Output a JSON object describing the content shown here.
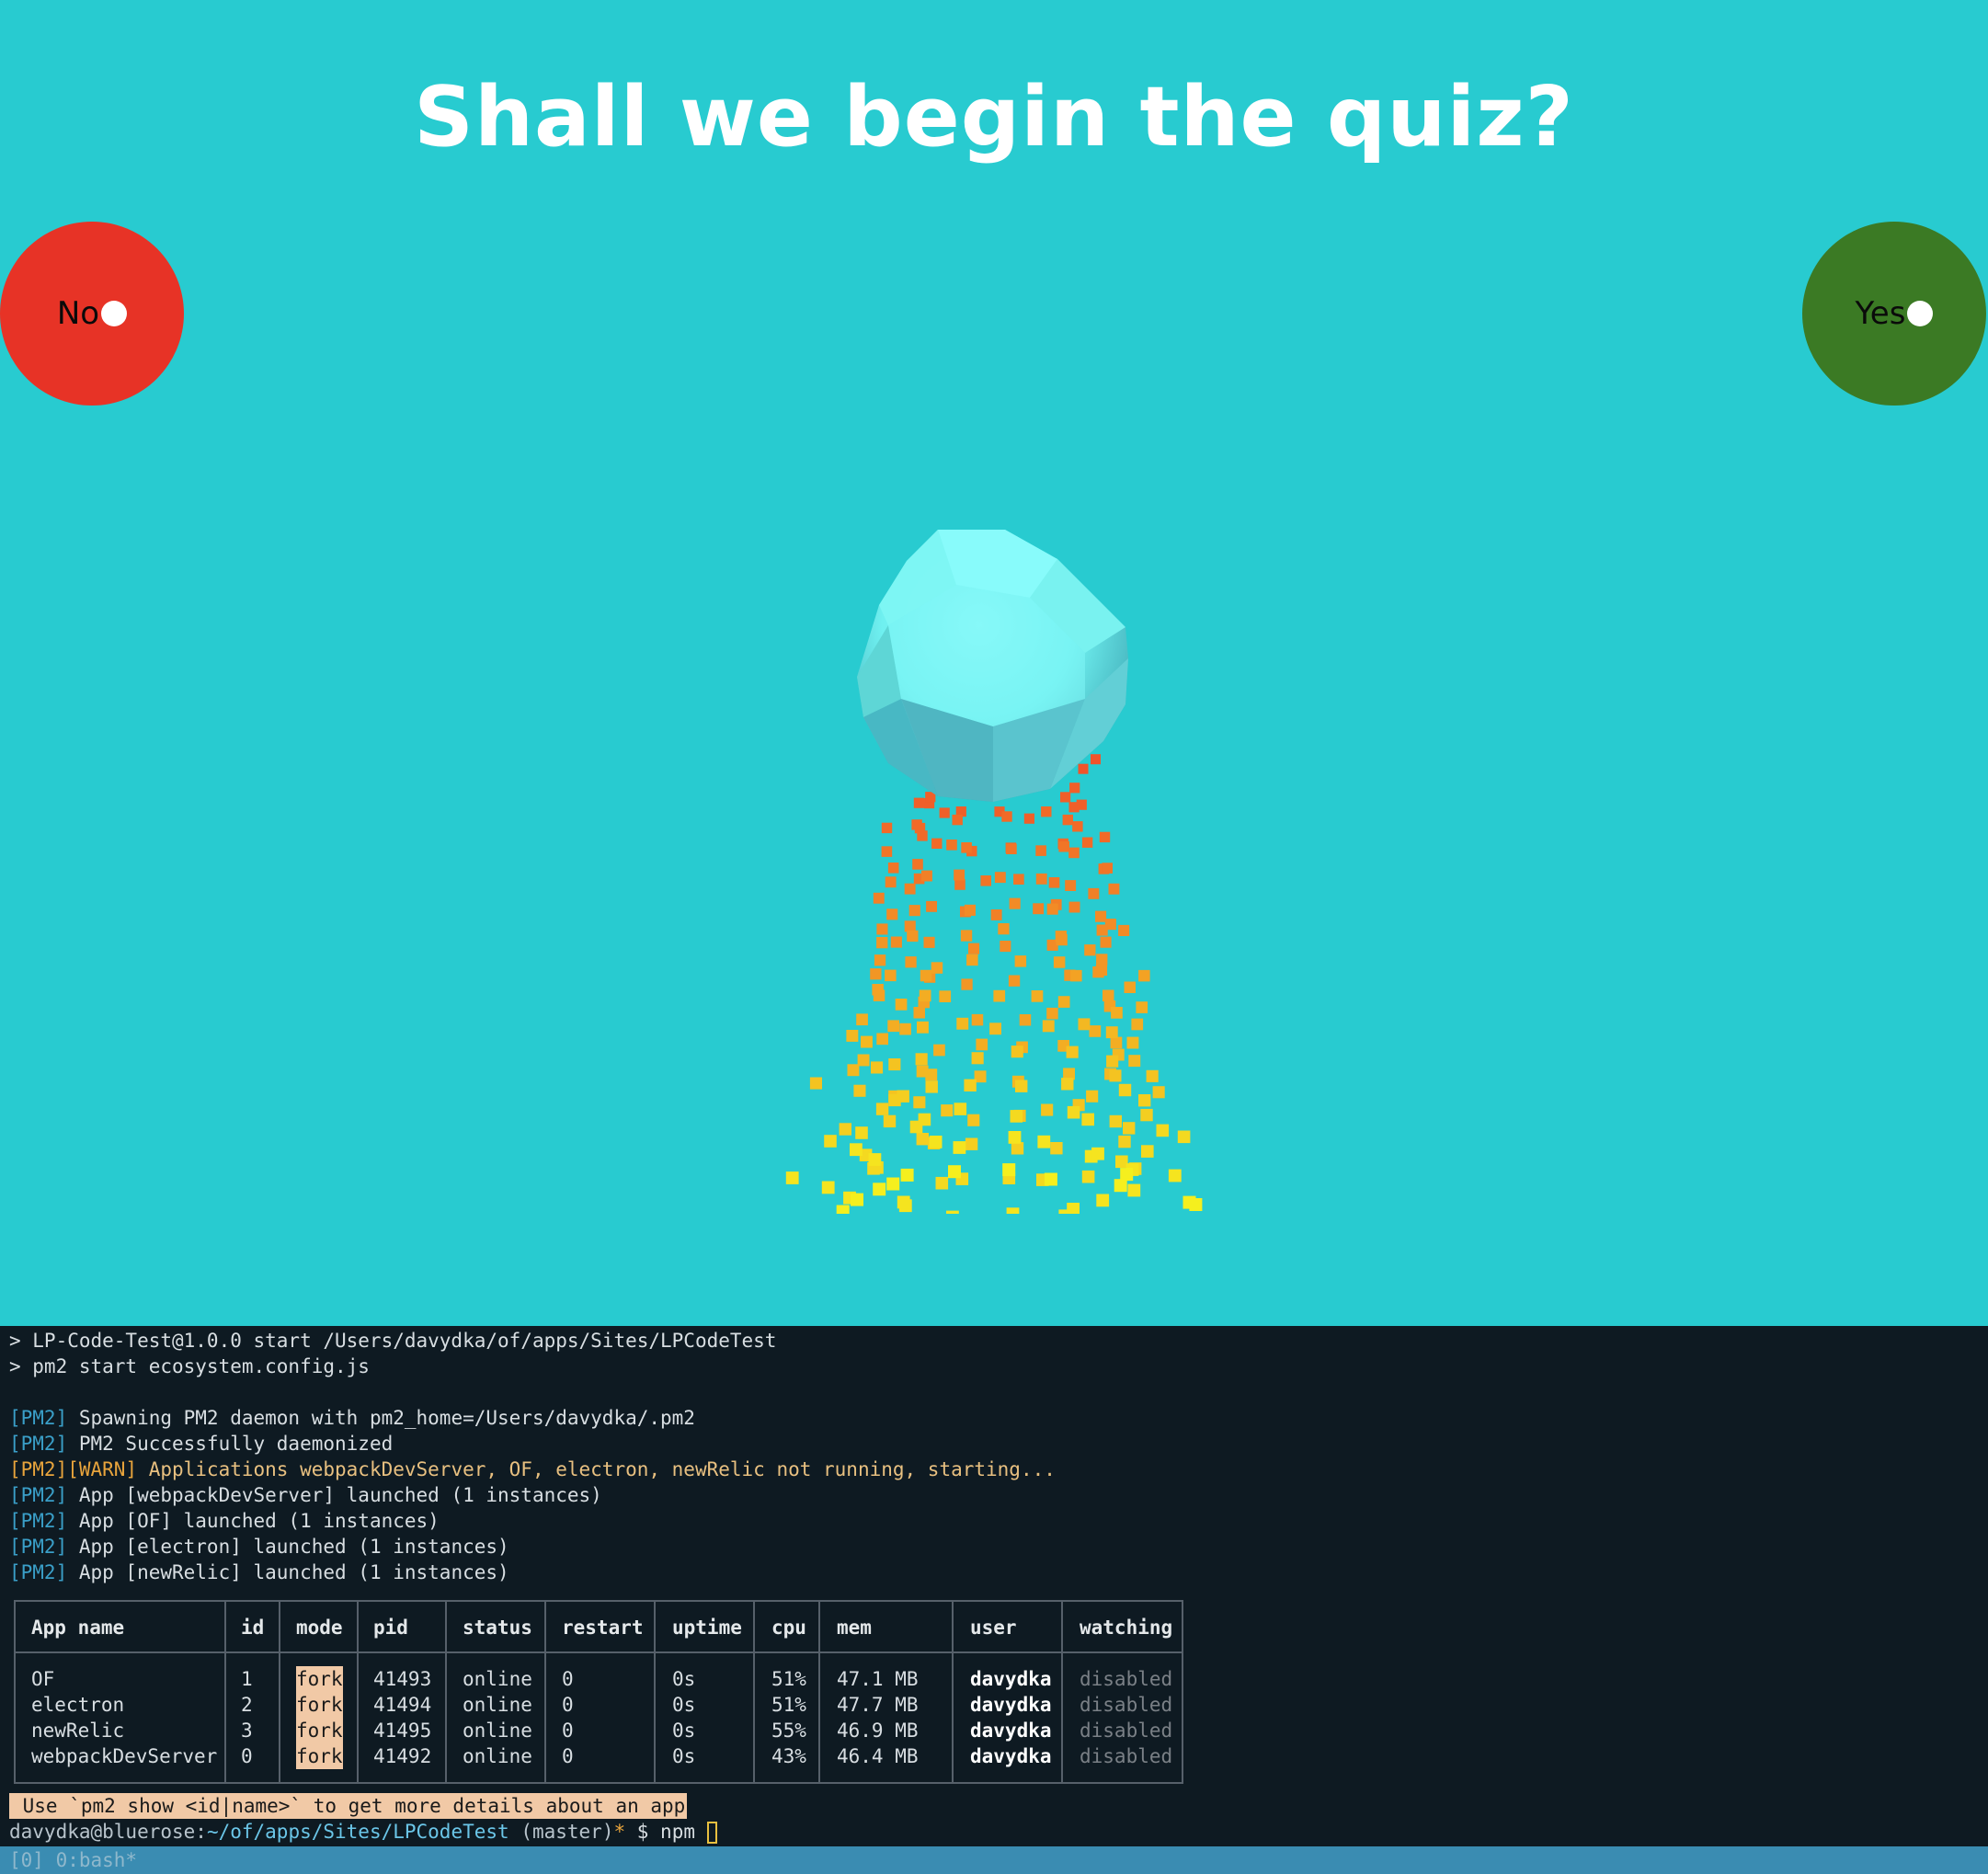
{
  "quiz": {
    "title": "Shall we begin the quiz?",
    "no_label": "No",
    "yes_label": "Yes"
  },
  "colors": {
    "background": "#28cbd0",
    "no_button": "#e73326",
    "yes_button": "#3b7a24",
    "sphere": "#6ff0f0",
    "particles_top": "#f0542a",
    "particles_bottom": "#f5ef1e"
  },
  "terminal": {
    "cmd_line_1": "> LP-Code-Test@1.0.0 start /Users/davydka/of/apps/Sites/LPCodeTest",
    "cmd_line_2": "> pm2 start ecosystem.config.js",
    "log": [
      {
        "tag": "[PM2]",
        "text": " Spawning PM2 daemon with pm2_home=/Users/davydka/.pm2"
      },
      {
        "tag": "[PM2]",
        "text": " PM2 Successfully daemonized"
      },
      {
        "tag": "[PM2][WARN]",
        "text": " Applications webpackDevServer, OF, electron, newRelic not running, starting..."
      },
      {
        "tag": "[PM2]",
        "text": " App [webpackDevServer] launched (1 instances)"
      },
      {
        "tag": "[PM2]",
        "text": " App [OF] launched (1 instances)"
      },
      {
        "tag": "[PM2]",
        "text": " App [electron] launched (1 instances)"
      },
      {
        "tag": "[PM2]",
        "text": " App [newRelic] launched (1 instances)"
      }
    ],
    "table": {
      "headers": [
        "App name",
        "id",
        "mode",
        "pid",
        "status",
        "restart",
        "uptime",
        "cpu",
        "mem",
        "user",
        "watching"
      ],
      "rows": [
        [
          "OF",
          "1",
          "fork",
          "41493",
          "online",
          "0",
          "0s",
          "51%",
          "47.1 MB",
          "davydka",
          "disabled"
        ],
        [
          "electron",
          "2",
          "fork",
          "41494",
          "online",
          "0",
          "0s",
          "51%",
          "47.7 MB",
          "davydka",
          "disabled"
        ],
        [
          "newRelic",
          "3",
          "fork",
          "41495",
          "online",
          "0",
          "0s",
          "55%",
          "46.9 MB",
          "davydka",
          "disabled"
        ],
        [
          "webpackDevServer",
          "0",
          "fork",
          "41492",
          "online",
          "0",
          "0s",
          "43%",
          "46.4 MB",
          "davydka",
          "disabled"
        ]
      ]
    },
    "hint": " Use `pm2 show <id|name>` to get more details about an app",
    "prompt": {
      "host": "davydka@bluerose:",
      "path": "~/of/apps/Sites/LPCodeTest",
      "branch": " (master)",
      "dirty": "*",
      "tail": " $ npm "
    },
    "statusbar": "[0] 0:bash*"
  }
}
